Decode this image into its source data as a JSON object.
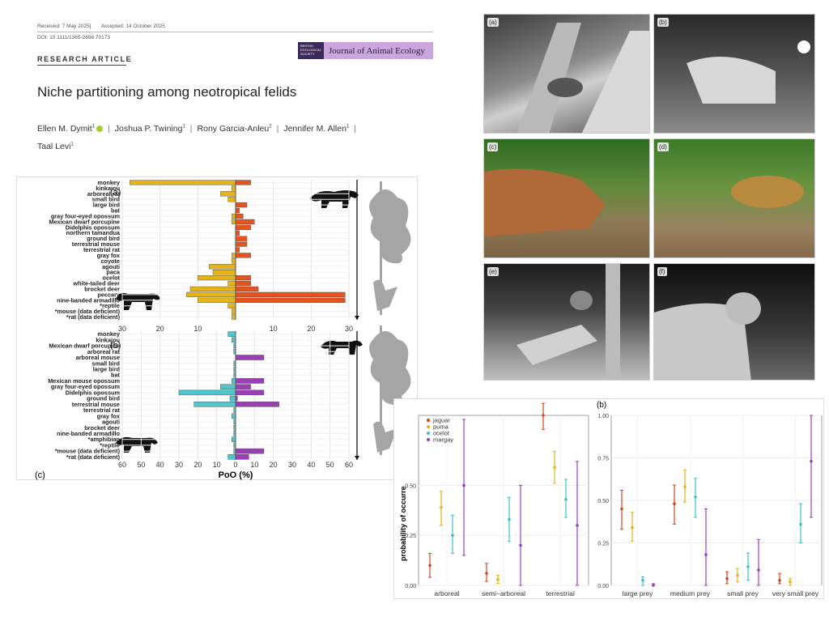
{
  "header": {
    "received": "Received: 7 May 2025",
    "accepted": "Accepted: 14 October 2025",
    "doi": "DOI: 10.1111/1365-2656.70173",
    "article_type": "RESEARCH ARTICLE",
    "journal": "Journal of Animal Ecology",
    "journal_logo_text": "BRITISH ECOLOGICAL SOCIETY",
    "title": "Niche partitioning among neotropical felids",
    "authors": [
      {
        "name": "Ellen M. Dymit",
        "sup": "1"
      },
      {
        "name": "Joshua P. Twining",
        "sup": "1"
      },
      {
        "name": "Rony Garcia-Anleu",
        "sup": "2"
      },
      {
        "name": "Jennifer M. Allen",
        "sup": "1"
      },
      {
        "name": "Taal Levi",
        "sup": "1"
      }
    ]
  },
  "photos": [
    {
      "label": "(a)"
    },
    {
      "label": "(b)"
    },
    {
      "label": "(c)"
    },
    {
      "label": "(d)"
    },
    {
      "label": "(e)"
    },
    {
      "label": "(f)"
    }
  ],
  "figure_labels": {
    "panel_a": "(a)",
    "panel_b": "(b)",
    "panel_c": "(c)",
    "panel_b2": "(b)"
  },
  "chart_data": [
    {
      "type": "bar",
      "panel": "(a)",
      "orientation": "horizontal-diverging",
      "xlabel": "",
      "categories": [
        "monkey",
        "kinkajou",
        "arboreal rat",
        "small bird",
        "large bird",
        "bat",
        "gray four-eyed opossum",
        "Mexican dwarf porcupine",
        "Didelphis opossum",
        "northern tamandua",
        "ground bird",
        "terrestrial mouse",
        "terrestrial rat",
        "gray fox",
        "coyote",
        "agouti",
        "paca",
        "ocelot",
        "white-tailed deer",
        "brocket deer",
        "peccary",
        "nine-banded armadillo",
        "*reptile",
        "*mouse (data deficient)",
        "*rat (data deficient)"
      ],
      "series": [
        {
          "name": "",
          "color": "#e7b416",
          "side": "left",
          "values": [
            28,
            1,
            4,
            2,
            0,
            0,
            1,
            1,
            0,
            0,
            0,
            0,
            0,
            1,
            1,
            7,
            6,
            10,
            2,
            12,
            13,
            10,
            2,
            1,
            1
          ]
        },
        {
          "name": "",
          "color": "#e8531d",
          "side": "right",
          "values": [
            4,
            0,
            0,
            0,
            3,
            1,
            2,
            5,
            4,
            1,
            3,
            3,
            1,
            4,
            0,
            0,
            0,
            4,
            4,
            6,
            29,
            29,
            0,
            0,
            0
          ]
        }
      ],
      "tick_labels": [
        "30",
        "20",
        "10",
        "",
        "10",
        "20",
        "30"
      ],
      "xlim": [
        -30,
        30
      ]
    },
    {
      "type": "bar",
      "panel": "(b)",
      "orientation": "horizontal-diverging",
      "xlabel": "PoO (%)",
      "categories": [
        "monkey",
        "kinkajou",
        "Mexican dwarf porcupine",
        "arboreal rat",
        "arboreal mouse",
        "small bird",
        "large bird",
        "bat",
        "Mexican mouse opossum",
        "gray four-eyed opossum",
        "Didelphis opossum",
        "ground bird",
        "terrestrial mouse",
        "terrestrial rat",
        "gray fox",
        "agouti",
        "brocket deer",
        "nine-banded armadillo",
        "*amphibian",
        "*reptile",
        "*mouse (data deficient)",
        "*rat (data deficient)"
      ],
      "series": [
        {
          "name": "",
          "color": "#4fc6cc",
          "side": "left",
          "values": [
            4,
            2,
            1,
            1,
            0,
            1,
            1,
            1,
            2,
            8,
            30,
            3,
            22,
            1,
            2,
            1,
            1,
            1,
            2,
            1,
            1,
            4
          ]
        },
        {
          "name": "",
          "color": "#9b3fb7",
          "side": "right",
          "values": [
            0,
            0,
            0,
            0,
            15,
            0,
            0,
            0,
            15,
            8,
            15,
            1,
            23,
            0,
            0,
            0,
            0,
            0,
            0,
            0,
            15,
            7
          ]
        }
      ],
      "tick_labels": [
        "60",
        "50",
        "40",
        "30",
        "20",
        "10",
        "0",
        "10",
        "20",
        "30",
        "40",
        "50",
        "60"
      ],
      "xlim": [
        -60,
        60
      ]
    },
    {
      "type": "scatter",
      "panel": "(a)",
      "subtype": "point-range",
      "ylabel": "probability of occurre",
      "categories": [
        "arboreal",
        "semi−arboreal",
        "terrestrial"
      ],
      "series": [
        {
          "name": "jaguar",
          "color": "#d3461e",
          "mean": [
            0.1,
            0.06,
            0.85
          ],
          "low": [
            0.04,
            0.02,
            0.78
          ],
          "high": [
            0.16,
            0.11,
            0.91
          ]
        },
        {
          "name": "puma",
          "color": "#e5b31b",
          "mean": [
            0.39,
            0.03,
            0.59
          ],
          "low": [
            0.3,
            0.01,
            0.51
          ],
          "high": [
            0.47,
            0.05,
            0.67
          ]
        },
        {
          "name": "ocelot",
          "color": "#3fc0c4",
          "mean": [
            0.25,
            0.33,
            0.43
          ],
          "low": [
            0.16,
            0.22,
            0.34
          ],
          "high": [
            0.35,
            0.44,
            0.53
          ]
        },
        {
          "name": "margay",
          "color": "#9b3fb7",
          "mean": [
            0.5,
            0.2,
            0.3
          ],
          "low": [
            0.15,
            0.0,
            0.0
          ],
          "high": [
            0.83,
            0.5,
            0.62
          ]
        }
      ],
      "ylim": [
        0,
        0.85
      ],
      "yticks": [
        "0.00",
        "0.25",
        "0.50"
      ]
    },
    {
      "type": "scatter",
      "panel": "(b)",
      "subtype": "point-range",
      "ylabel": "",
      "categories": [
        "large prey",
        "medium prey",
        "small prey",
        "very small prey"
      ],
      "series": [
        {
          "name": "jaguar",
          "color": "#d3461e",
          "mean": [
            0.45,
            0.48,
            0.04,
            0.03
          ],
          "low": [
            0.33,
            0.36,
            0.01,
            0.01
          ],
          "high": [
            0.56,
            0.59,
            0.08,
            0.07
          ]
        },
        {
          "name": "puma",
          "color": "#e5b31b",
          "mean": [
            0.34,
            0.58,
            0.06,
            0.02
          ],
          "low": [
            0.26,
            0.49,
            0.02,
            0.0
          ],
          "high": [
            0.43,
            0.68,
            0.1,
            0.04
          ]
        },
        {
          "name": "ocelot",
          "color": "#3fc0c4",
          "mean": [
            0.03,
            0.52,
            0.11,
            0.36
          ],
          "low": [
            0.0,
            0.4,
            0.03,
            0.25
          ],
          "high": [
            0.05,
            0.63,
            0.19,
            0.48
          ]
        },
        {
          "name": "margay",
          "color": "#9b3fb7",
          "mean": [
            0.0,
            0.18,
            0.09,
            0.73
          ],
          "low": [
            0.0,
            0.0,
            0.0,
            0.4
          ],
          "high": [
            0.01,
            0.45,
            0.27,
            1.0
          ]
        }
      ],
      "ylim": [
        0,
        1.0
      ],
      "yticks": [
        "0.00",
        "0.25",
        "0.50",
        "0.75",
        "1.00"
      ]
    }
  ]
}
